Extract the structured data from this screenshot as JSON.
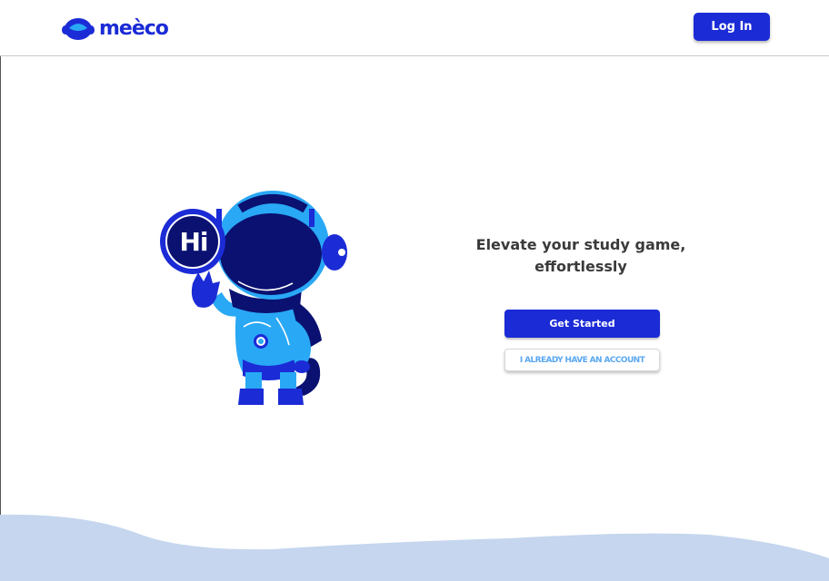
{
  "header": {
    "logo_text": "meèco",
    "login_label": "Log In"
  },
  "hero": {
    "mascot_bubble_text": "Hi",
    "headline_line1": "Elevate your study game,",
    "headline_line2": "effortlessly",
    "get_started_label": "Get Started",
    "have_account_label": "I ALREADY HAVE AN ACCOUNT"
  },
  "icons": [
    "logo-helmet-icon",
    "mascot-astronaut"
  ],
  "colors": {
    "brand": "#1b2bd6",
    "accent_light": "#5aa8f0",
    "mascot_dark": "#0a1170",
    "mascot_light": "#29a8f5",
    "wave": "#c5d6ee"
  }
}
